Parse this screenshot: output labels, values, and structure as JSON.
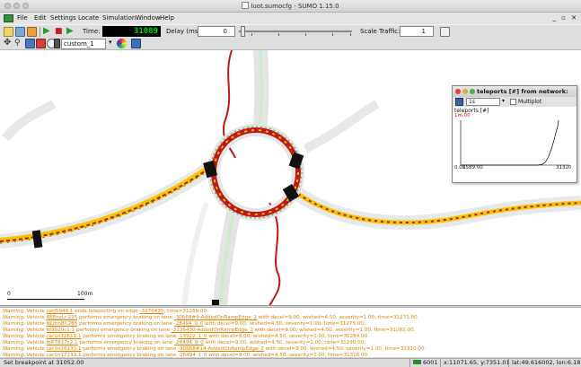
{
  "window": {
    "title": "luot.sumocfg - SUMO 1.15.0",
    "controls": "_ ▫ ✕"
  },
  "menu": [
    "File",
    "Edit",
    "Settings",
    "Locate",
    "Simulation",
    "Window",
    "Help"
  ],
  "toolbar": {
    "time_label": "Time:",
    "time_value": "31089",
    "delay_label": "Delay (ms):",
    "delay_value": "0",
    "scale_label": "Scale Traffic:",
    "scale_value": "1"
  },
  "view": {
    "scheme": "custom_1",
    "scale_start": "0",
    "scale_end": "100m"
  },
  "plot_window": {
    "title": "teleports [#] from network:",
    "attribute": "1s",
    "multiplot_label": "Multiplot",
    "y_label": "teleports [#]",
    "y_max": "1m.00",
    "y_min": "0.00",
    "x_min": "1589.00",
    "x_max": "31320"
  },
  "messages": [
    {
      "prefix": "Warning: Vehicle ",
      "vehicle": "carJ5944.1",
      "text": " ends teleporting on edge ",
      "edge": "-3276435",
      "suffix": ", time=31269.00."
    },
    {
      "prefix": "Warning: Vehicle ",
      "vehicle": "BEEnsLr.225",
      "text": " performs emergency braking on lane ",
      "edge": "-30668#9-AddedOnRampEdge_2",
      "suffix": " with decel=9.00, wished=4.50, severity=1.00, time=31271.00."
    },
    {
      "prefix": "Warning: Vehicle ",
      "vehicle": "NLrhn8t.265",
      "text": " performs emergency braking on lane ",
      "edge": "-28494_0_0",
      "suffix": " with decel=9.00, wished=4.50, severity=1.00, time=31275.00."
    },
    {
      "prefix": "Warning: Vehicle ",
      "vehicle": "fd9920c1.1",
      "text": " performs emergency braking on lane ",
      "edge": "-3136430-AddedOnRampEdge_2",
      "suffix": " with decel=9.00, wished=4.50, severity=1.00, time=31282.00."
    },
    {
      "prefix": "Warning: Vehicle ",
      "vehicle": "car1n32611.1",
      "text": " performs emergency braking on lane ",
      "edge": "-13922_1_0",
      "suffix": " with decel=9.00, wished=4.50, severity=1.00, time=31284.00."
    },
    {
      "prefix": "Warning: Vehicle ",
      "vehicle": "fe67827c2.1",
      "text": " performs emergency braking on lane ",
      "edge": "-28494_0_0",
      "suffix": " with decel=9.00, wished=4.50, severity=1.00, time=31290.00."
    },
    {
      "prefix": "Warning: Vehicle ",
      "vehicle": "car1n26133.1",
      "text": " performs emergency braking on lane ",
      "edge": "-30668#14-AddedOnRampEdge_2",
      "suffix": " with decel=9.00, wished=4.50, severity=1.00, time=31310.00."
    },
    {
      "prefix": "Warning: Vehicle ",
      "vehicle": "car1n17233.1",
      "text": " performs emergency braking on lane ",
      "edge": "-28494_1_0",
      "suffix": " with decel=9.00, wished=4.50, severity=1.00, time=31316.00."
    }
  ],
  "status": {
    "message": "Set breakpoint at 31052.00",
    "vehicles": "6001",
    "coords": "x:11071.65, y:7351.01",
    "geo": "lat:49.616002, lon:6.18295"
  },
  "colors": {
    "time_bg": "#000000",
    "time_fg": "#00e000",
    "warning": "#e08000",
    "jam": "#c01818",
    "free": "#f0c800",
    "road": "#e6e6e6"
  }
}
